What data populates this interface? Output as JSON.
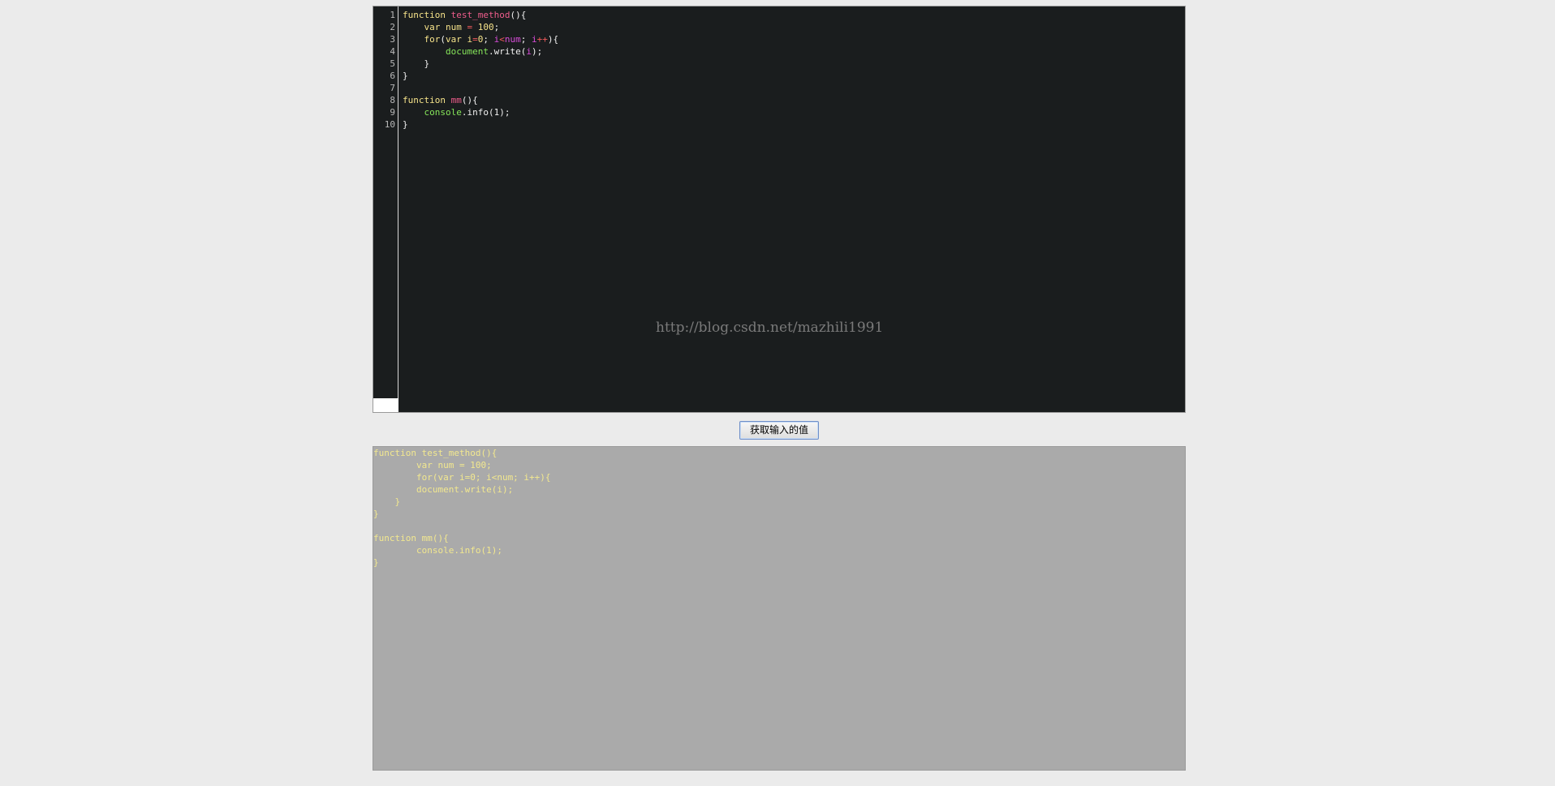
{
  "editor": {
    "line_numbers": [
      "1",
      "2",
      "3",
      "4",
      "5",
      "6",
      "7",
      "8",
      "9",
      "10"
    ],
    "lines": [
      [
        {
          "t": "function ",
          "c": "kw"
        },
        {
          "t": "test_method",
          "c": "fn"
        },
        {
          "t": "(){",
          "c": "pln"
        }
      ],
      [
        {
          "t": "    var ",
          "c": "kw"
        },
        {
          "t": "num",
          "c": "var"
        },
        {
          "t": " = ",
          "c": "op"
        },
        {
          "t": "100",
          "c": "num"
        },
        {
          "t": ";",
          "c": "pln"
        }
      ],
      [
        {
          "t": "    for",
          "c": "kw"
        },
        {
          "t": "(",
          "c": "pln"
        },
        {
          "t": "var ",
          "c": "kw"
        },
        {
          "t": "i",
          "c": "var"
        },
        {
          "t": "=",
          "c": "op"
        },
        {
          "t": "0",
          "c": "num"
        },
        {
          "t": "; ",
          "c": "pln"
        },
        {
          "t": "i",
          "c": "var2"
        },
        {
          "t": "<",
          "c": "op"
        },
        {
          "t": "num",
          "c": "var2"
        },
        {
          "t": "; ",
          "c": "pln"
        },
        {
          "t": "i",
          "c": "var2"
        },
        {
          "t": "++",
          "c": "op"
        },
        {
          "t": "){",
          "c": "pln"
        }
      ],
      [
        {
          "t": "        ",
          "c": "pln"
        },
        {
          "t": "document",
          "c": "obj"
        },
        {
          "t": ".write(",
          "c": "pln"
        },
        {
          "t": "i",
          "c": "var2"
        },
        {
          "t": ");",
          "c": "pln"
        }
      ],
      [
        {
          "t": "    }",
          "c": "pln"
        }
      ],
      [
        {
          "t": "}",
          "c": "pln"
        }
      ],
      [
        {
          "t": "",
          "c": "pln"
        }
      ],
      [
        {
          "t": "function ",
          "c": "kw"
        },
        {
          "t": "mm",
          "c": "fn"
        },
        {
          "t": "(){",
          "c": "pln"
        }
      ],
      [
        {
          "t": "    ",
          "c": "pln"
        },
        {
          "t": "console",
          "c": "obj"
        },
        {
          "t": ".info(1);",
          "c": "pln"
        }
      ],
      [
        {
          "t": "}",
          "c": "pln"
        }
      ]
    ],
    "watermark": "http://blog.csdn.net/mazhili1991"
  },
  "button": {
    "label": "获取输入的值"
  },
  "output": {
    "lines": [
      "function test_method(){",
      "        var num = 100;",
      "        for(var i=0; i<num; i++){",
      "        document.write(i);",
      "    }",
      "}",
      "",
      "function mm(){",
      "        console.info(1);",
      "}"
    ]
  },
  "colors": {
    "editor_bg": "#1a1d1e",
    "output_bg": "#aaaaaa",
    "output_text": "#f2e88f",
    "page_bg": "#ebebeb"
  }
}
